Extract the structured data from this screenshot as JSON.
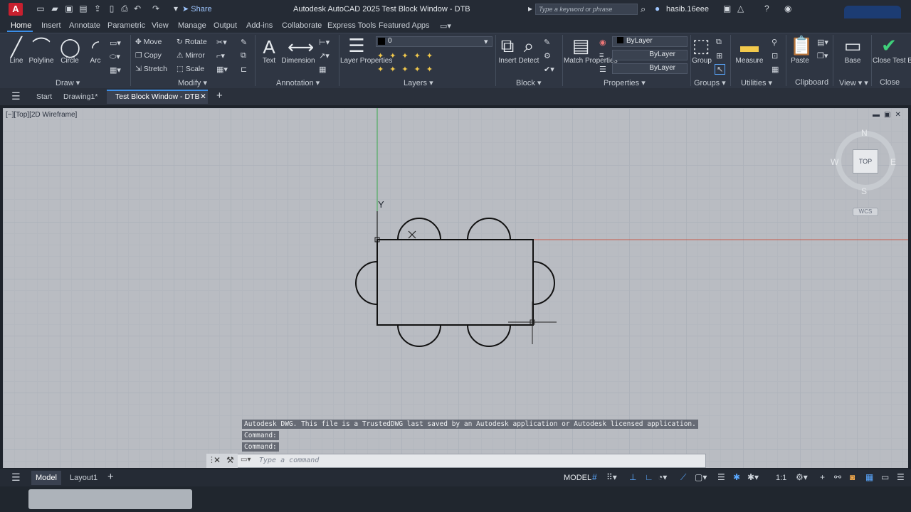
{
  "titlebar": {
    "app_logo": "A",
    "share_label": "Share",
    "window_title": "Autodesk AutoCAD 2025   Test Block Window - DTB",
    "search_placeholder": "Type a keyword or phrase",
    "user_name": "hasib.16eee"
  },
  "ribbon_tabs": [
    "Home",
    "Insert",
    "Annotate",
    "Parametric",
    "View",
    "Manage",
    "Output",
    "Add-ins",
    "Collaborate",
    "Express Tools",
    "Featured Apps"
  ],
  "draw": {
    "panel": "Draw",
    "line": "Line",
    "polyline": "Polyline",
    "circle": "Circle",
    "arc": "Arc"
  },
  "modify": {
    "panel": "Modify",
    "move": "Move",
    "rotate": "Rotate",
    "copy": "Copy",
    "mirror": "Mirror",
    "stretch": "Stretch",
    "scale": "Scale"
  },
  "annotation": {
    "panel": "Annotation",
    "text": "Text",
    "dimension": "Dimension"
  },
  "layers": {
    "panel": "Layers",
    "layer_properties": "Layer Properties",
    "current_layer": "0"
  },
  "block": {
    "panel": "Block",
    "insert": "Insert",
    "detect": "Detect"
  },
  "properties": {
    "panel": "Properties",
    "match_properties": "Match Properties",
    "color": "ByLayer",
    "linetype": "ByLayer",
    "lineweight": "ByLayer"
  },
  "groups": {
    "panel": "Groups",
    "group": "Group"
  },
  "utilities": {
    "panel": "Utilities",
    "measure": "Measure"
  },
  "clipboard": {
    "panel": "Clipboard",
    "paste": "Paste"
  },
  "view_panel": {
    "panel": "View",
    "base": "Base"
  },
  "close_panel": {
    "panel": "Close",
    "close_test_block": "Close Test Block"
  },
  "doc_tabs": {
    "start": "Start",
    "drawing1": "Drawing1*",
    "active": "Test Block Window - DTB"
  },
  "viewport": {
    "label": "[−][Top][2D Wireframe]",
    "y_axis_label": "Y",
    "viewcube_top": "TOP",
    "compass_n": "N",
    "compass_s": "S",
    "compass_e": "E",
    "compass_w": "W",
    "wcs": "WCS"
  },
  "command_history": [
    "Autodesk DWG.  This file is a TrustedDWG last saved by an Autodesk application or Autodesk licensed application.",
    "Command:",
    "Command:"
  ],
  "command_input": {
    "placeholder": "Type a command"
  },
  "statusbar": {
    "model_tab": "Model",
    "layout_tab": "Layout1",
    "model_badge": "MODEL",
    "scale": "1:1"
  }
}
